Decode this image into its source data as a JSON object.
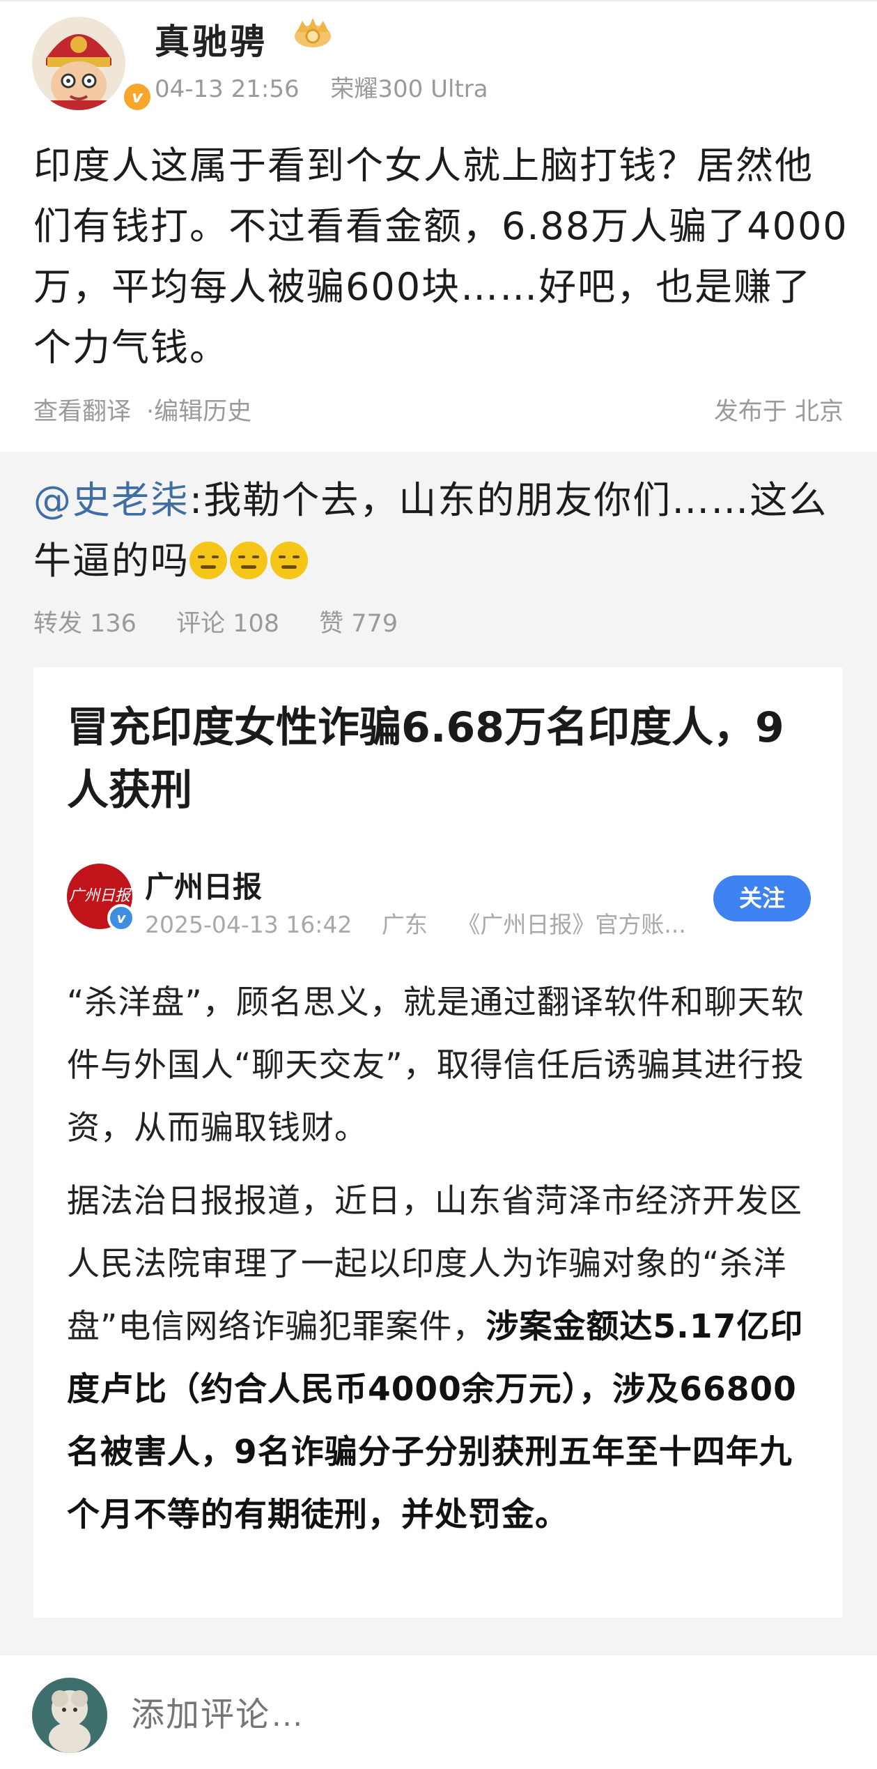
{
  "post": {
    "author": "真驰骋",
    "time": "04-13 21:56",
    "device": "荣耀300 Ultra",
    "text": "印度人这属于看到个女人就上脑打钱？居然他们有钱打。不过看看金额，6.88万人骗了4000万，平均每人被骗600块……好吧，也是赚了个力气钱。",
    "translate_label": "查看翻译",
    "separator": "·",
    "history_label": "编辑历史",
    "location": "发布于 北京",
    "badges": {
      "verified": "v"
    }
  },
  "repost": {
    "mention": "@史老柒",
    "text": ":我勒个去，山东的朋友你们……这么牛逼的吗",
    "stats": {
      "repost": "转发 136",
      "comment": "评论 108",
      "like": "赞 779"
    }
  },
  "article": {
    "title": "冒充印度女性诈骗6.68万名印度人，9人获刑",
    "source_name": "广州日报",
    "source_logo_text": "广州日报",
    "date": "2025-04-13 16:42",
    "region": "广东",
    "account_desc": "《广州日报》官方账...",
    "follow_label": "关注",
    "para1": "“杀洋盘”，顾名思义，就是通过翻译软件和聊天软件与外国人“聊天交友”，取得信任后诱骗其进行投资，从而骗取钱财。",
    "para2_plain": "据法治日报报道，近日，山东省菏泽市经济开发区人民法院审理了一起以印度人为诈骗对象的“杀洋盘”电信网络诈骗犯罪案件，",
    "para2_bold": "涉案金额达5.17亿印度卢比（约合人民币4000余万元），涉及66800名被害人，9名诈骗分子分别获刑五年至十四年九个月不等的有期徒刑，并处罚金。"
  },
  "comment_bar": {
    "placeholder": "添加评论…"
  },
  "colors": {
    "mention": "#3f6ea7",
    "follow_button": "#3d82f0",
    "repost_bg": "#f4f4f4",
    "muted_text": "#9a9a9a"
  }
}
